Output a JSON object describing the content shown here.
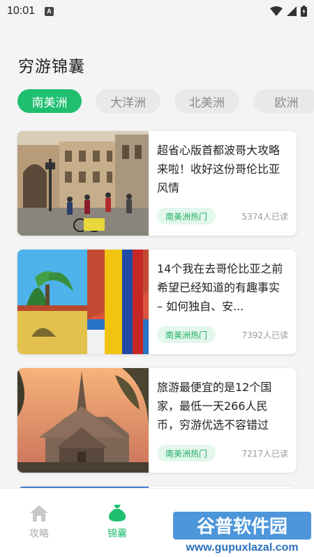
{
  "status_bar": {
    "time": "10:01",
    "notification_icon": "a-icon"
  },
  "page_title": "穷游锦囊",
  "tabs": [
    {
      "label": "南美洲",
      "active": true
    },
    {
      "label": "大洋洲",
      "active": false
    },
    {
      "label": "北美洲",
      "active": false
    },
    {
      "label": "欧洲",
      "active": false
    }
  ],
  "cards": [
    {
      "title": "超省心版首都波哥大攻略来啦！收好这份哥伦比亚风情",
      "tag": "南美洲热门",
      "reads": "5374人已读",
      "image": "bogota-street-photo"
    },
    {
      "title": "14个我在去哥伦比亚之前希望已经知道的有趣事实 – 如何独自、安...",
      "tag": "南美洲热门",
      "reads": "7392人已读",
      "image": "colombia-flag-photo"
    },
    {
      "title": "旅游最便宜的是12个国家，最低一天266人民币，穷游优选不容错过",
      "tag": "南美洲热门",
      "reads": "7217人已读",
      "image": "temple-sunset-photo"
    }
  ],
  "bottom_nav": [
    {
      "label": "攻略",
      "icon": "home-icon",
      "active": false
    },
    {
      "label": "锦囊",
      "icon": "bag-icon",
      "active": true
    }
  ],
  "watermark": {
    "brand": "谷普软件园",
    "url": "www.gupuxlazal.com"
  },
  "colors": {
    "accent": "#1fbf6f",
    "tag_bg": "#e3f7ec",
    "tag_text": "#1fae65",
    "inactive_tab_bg": "#e9e9e9",
    "inactive_text": "#888888"
  }
}
